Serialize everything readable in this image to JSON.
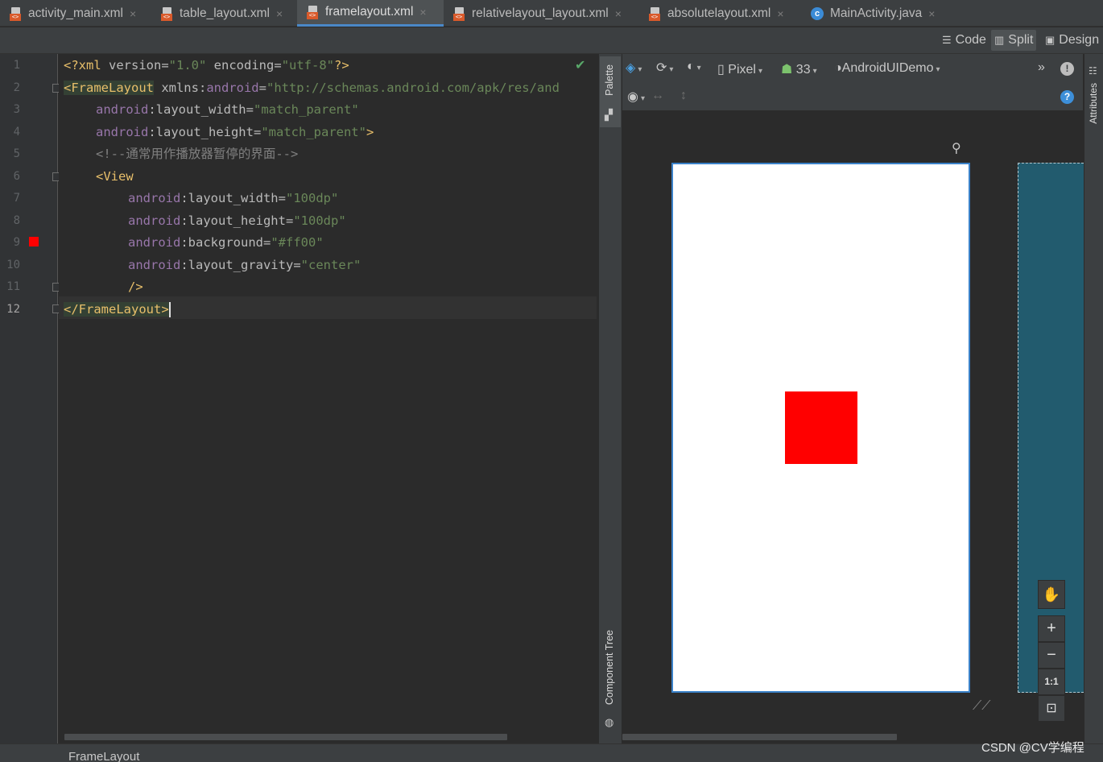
{
  "tabs": [
    {
      "label": "activity_main.xml",
      "icon": "xml-file-icon"
    },
    {
      "label": "table_layout.xml",
      "icon": "xml-file-icon"
    },
    {
      "label": "framelayout.xml",
      "icon": "xml-file-icon",
      "active": true
    },
    {
      "label": "relativelayout_layout.xml",
      "icon": "xml-file-icon"
    },
    {
      "label": "absolutelayout.xml",
      "icon": "xml-file-icon"
    },
    {
      "label": "MainActivity.java",
      "icon": "java-class-icon"
    }
  ],
  "view_modes": {
    "code": "Code",
    "split": "Split",
    "design": "Design",
    "active": "Split"
  },
  "editor": {
    "line_numbers": [
      "1",
      "2",
      "3",
      "4",
      "5",
      "6",
      "7",
      "8",
      "9",
      "10",
      "11",
      "12"
    ],
    "lines": [
      [
        "<?xml ",
        "version",
        "=",
        "\"1.0\"",
        " encoding",
        "=",
        "\"utf-8\"",
        "?>"
      ],
      [
        "<FrameLayout",
        " xmlns:",
        "android",
        "=",
        "\"http://schemas.android.com/apk/res/and"
      ],
      [
        "android",
        ":layout_width",
        "=",
        "\"match_parent\""
      ],
      [
        "android",
        ":layout_height",
        "=",
        "\"match_parent\"",
        ">"
      ],
      [
        "<!--通常用作播放器暂停的界面-->"
      ],
      [
        "<View"
      ],
      [
        "android",
        ":layout_width",
        "=",
        "\"100dp\""
      ],
      [
        "android",
        ":layout_height",
        "=",
        "\"100dp\""
      ],
      [
        "android",
        ":background",
        "=",
        "\"#ff00\""
      ],
      [
        "android",
        ":layout_gravity",
        "=",
        "\"center\""
      ],
      [
        "/>"
      ],
      [
        "</FrameLayout>"
      ]
    ],
    "current_line": "12",
    "gutter_color_marker": "#ff0000"
  },
  "side_panels": {
    "palette": "Palette",
    "component_tree": "Component Tree",
    "attributes": "Attributes"
  },
  "design_toolbar": {
    "device": "Pixel",
    "api_level": "33",
    "theme": "AndroidUIDemo",
    "more": "»",
    "icons": [
      "layers-icon",
      "orientation-icon",
      "night-mode-icon",
      "device-icon",
      "android-icon",
      "theme-icon",
      "warning-icon",
      "eye-icon",
      "horizontal-arrows-icon",
      "vertical-arrows-icon",
      "help-icon"
    ]
  },
  "preview": {
    "device_background": "#ffffff",
    "view_color": "#ff0000",
    "blueprint_color": "#225b6e"
  },
  "zoom_controls": {
    "pan": "✋",
    "zoom_in": "+",
    "zoom_out": "−",
    "actual_size": "1:1",
    "fit": "⊡"
  },
  "status_bar": {
    "breadcrumb": "FrameLayout"
  },
  "watermark": "CSDN @CV学编程"
}
